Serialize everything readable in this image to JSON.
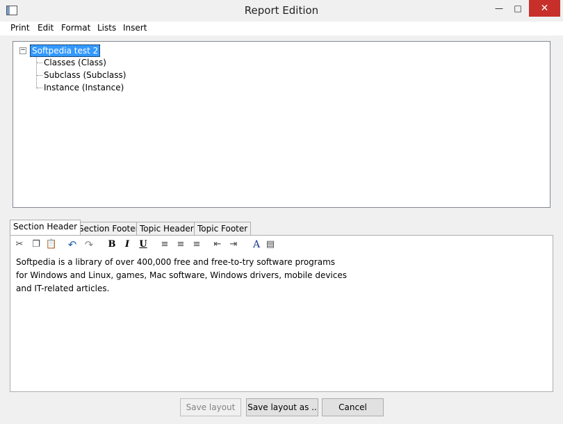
{
  "window": {
    "title": "Report Edition"
  },
  "menu": [
    "Print",
    "Edit",
    "Format",
    "Lists",
    "Insert"
  ],
  "tree": {
    "root": "Softpedia test 2",
    "children": [
      "Classes (Class)",
      "Subclass (Subclass)",
      "Instance (Instance)"
    ]
  },
  "tabs": [
    "Section Header",
    "Section Footer",
    "Topic Header",
    "Topic Footer"
  ],
  "editor": {
    "lines": [
      "Softpedia is a library of over 400,000 free and free-to-try software programs",
      "for Windows and Linux, games, Mac software, Windows drivers, mobile devices",
      "and IT-related articles."
    ]
  },
  "buttons": {
    "save_layout": "Save layout",
    "save_layout_as": "Save layout as ..",
    "cancel": "Cancel"
  },
  "colors": {
    "selection": "#3399ff",
    "close_button": "#c7302a"
  }
}
